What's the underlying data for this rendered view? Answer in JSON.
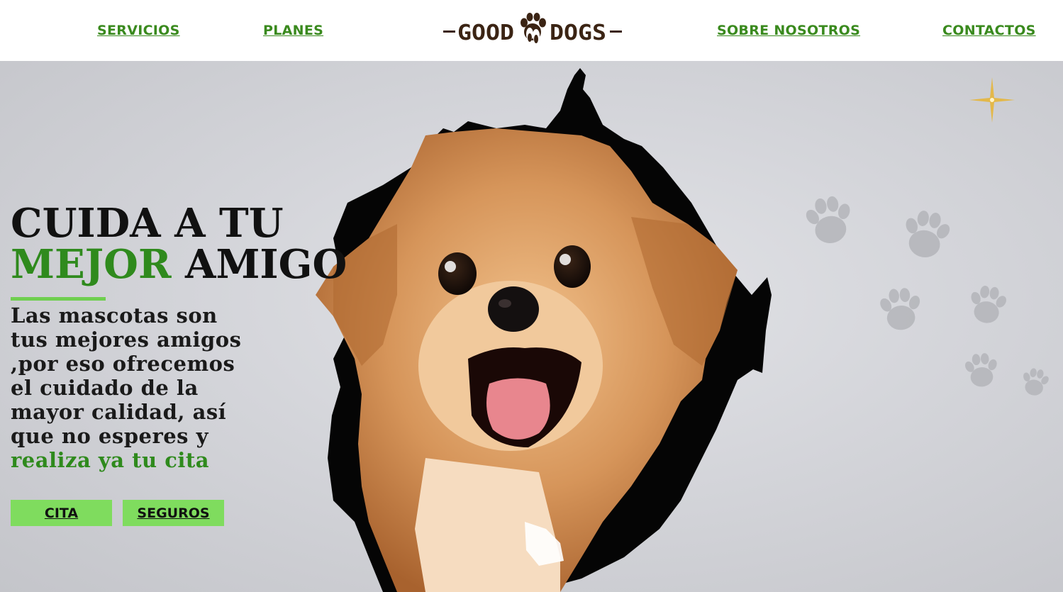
{
  "nav": {
    "links": [
      {
        "label": "SERVICIOS"
      },
      {
        "label": "PLANES"
      },
      {
        "label": "SOBRE NOSOTROS"
      },
      {
        "label": "CONTACTOS"
      }
    ],
    "logo": {
      "word_left": "GOOD",
      "word_right": "DOGS"
    }
  },
  "hero": {
    "headline_line1": "CUIDA A TU",
    "headline_accent": "MEJOR",
    "headline_line2_rest": " AMIGO",
    "body": "Las mascotas son tus mejores amigos ,por eso ofrecemos el cuidado de la mayor calidad, así que no esperes y ",
    "body_cta": "realiza ya tu cita",
    "buttons": [
      {
        "label": "CITA"
      },
      {
        "label": "SEGUROS"
      }
    ]
  },
  "colors": {
    "nav_link": "#3a8a1e",
    "accent_green": "#2f8a1d",
    "button_green": "#7fdc5e",
    "logo_brown": "#3b2414",
    "paw_gray": "#b4b5ba"
  },
  "icons": [
    "paw-print-icon",
    "sparkle-icon",
    "paw-logo-icon"
  ]
}
